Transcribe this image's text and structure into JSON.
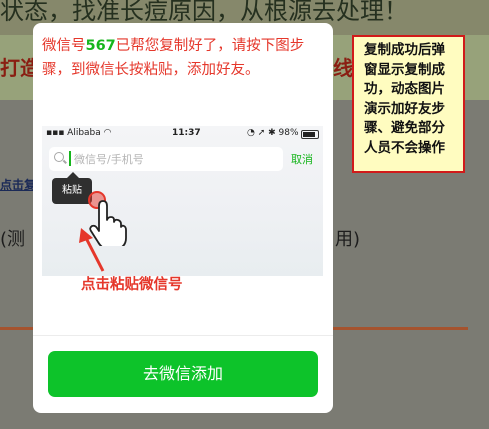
{
  "background": {
    "top_text": "状态，找准长痘原因，从根源去处理！",
    "band_text_left": "打造",
    "band_text_right": "线",
    "link_text": "点击复",
    "line2_left": "(测",
    "line2_right": "用)"
  },
  "modal": {
    "message_before": "微信号",
    "wechat_code": "567",
    "message_after": "已帮您复制好了，请按下图步骤，到微信长按粘贴，添加好友。",
    "demo": {
      "carrier": "Alibaba",
      "time": "11:37",
      "battery": "98%",
      "search_placeholder": "微信号/手机号",
      "cancel": "取消",
      "paste_tip": "粘贴"
    },
    "caption": "点击粘贴微信号",
    "add_button": "去微信添加"
  },
  "annotation": "复制成功后弹窗显示复制成功，动态图片演示加好友步骤、避免部分人员不会操作",
  "colors": {
    "accent_red": "#e5372b",
    "wechat_green": "#0dc32a",
    "note_bg": "#fffcc0"
  }
}
